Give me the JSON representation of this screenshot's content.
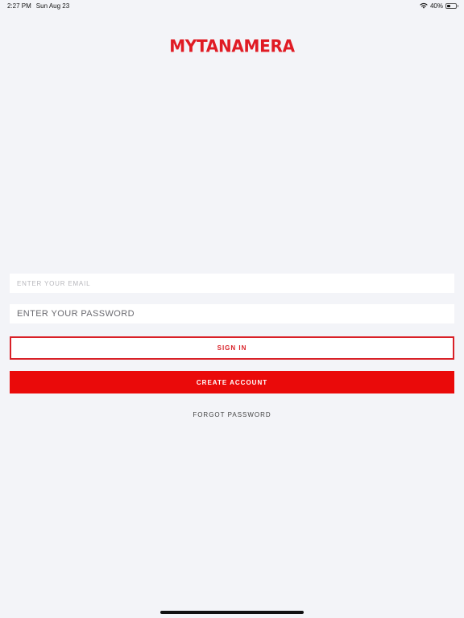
{
  "status_bar": {
    "time": "2:27 PM",
    "date": "Sun Aug 23",
    "battery": "40%",
    "battery_level": 0.4,
    "icons": [
      "wifi-icon",
      "battery-icon"
    ]
  },
  "logo": {
    "text": "MYTANAMERA",
    "color": "#e01b24"
  },
  "form": {
    "email_placeholder": "ENTER YOUR EMAIL",
    "email_value": "",
    "password_placeholder": "ENTER YOUR PASSWORD",
    "password_value": ""
  },
  "actions": {
    "sign_in_label": "SIGN IN",
    "create_account_label": "CREATE ACCOUNT",
    "forgot_password_label": "FORGOT PASSWORD"
  },
  "colors": {
    "accent": "#ea0a0a",
    "outline": "#d92027",
    "background": "#f3f4f8"
  }
}
